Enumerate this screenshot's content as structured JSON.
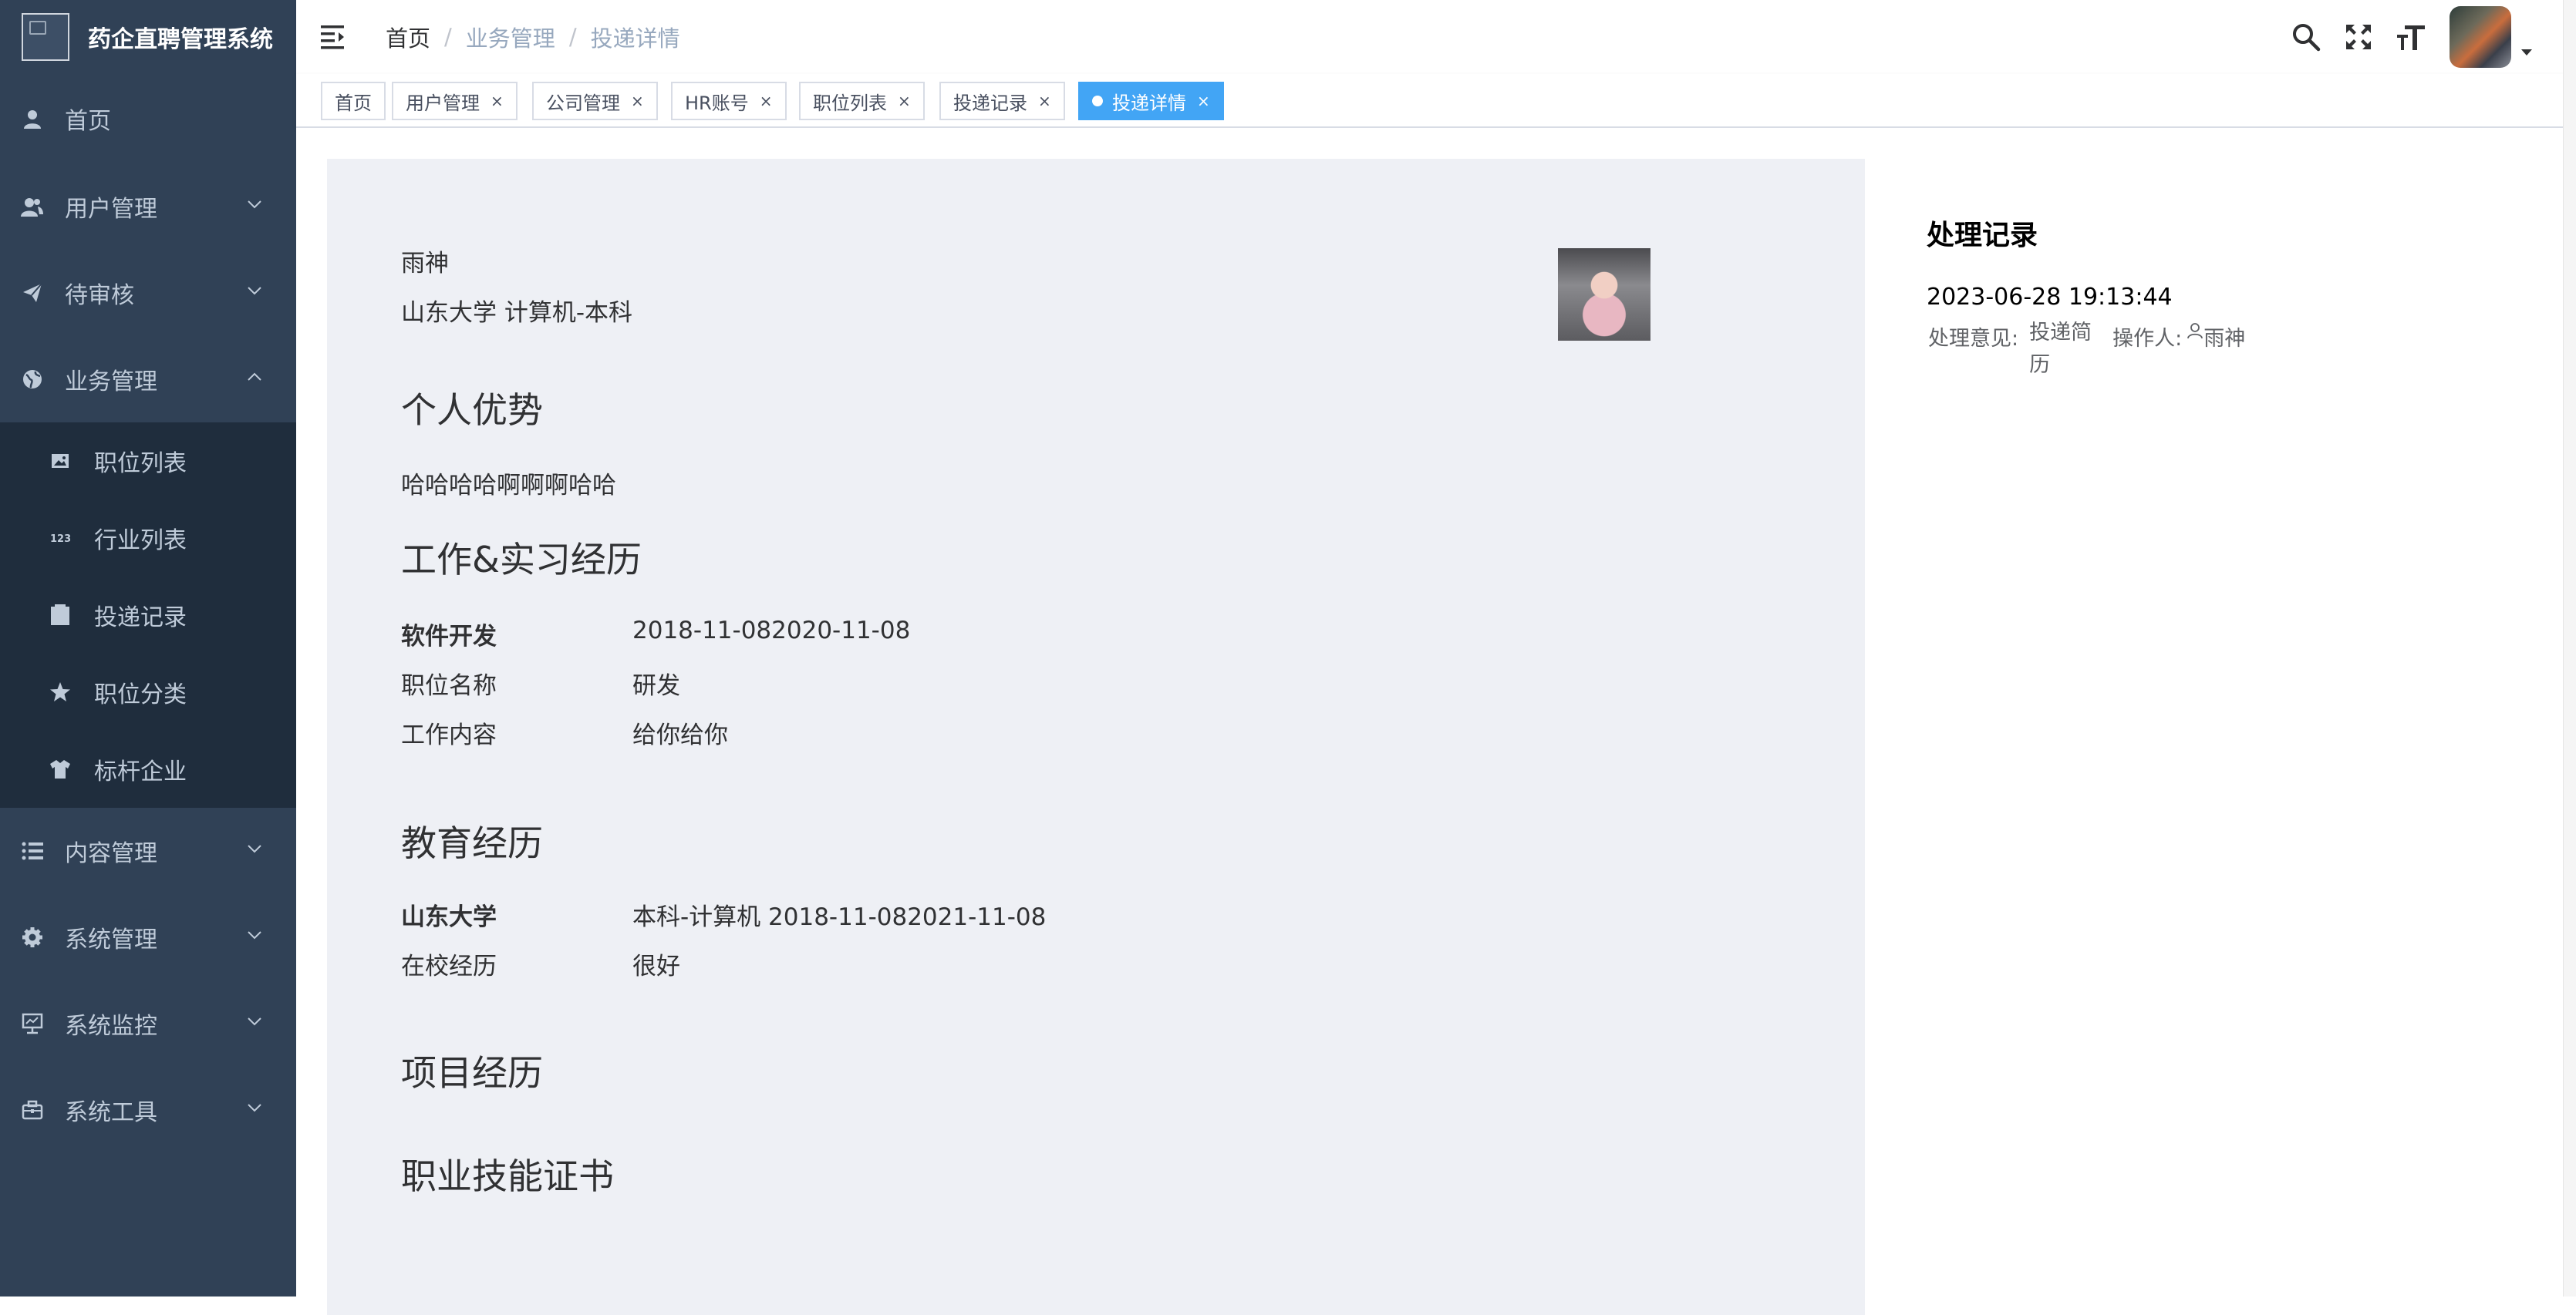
{
  "app": {
    "title": "药企直聘管理系统"
  },
  "sidebar": {
    "items": [
      {
        "label": "首页",
        "icon": "user-icon"
      },
      {
        "label": "用户管理",
        "icon": "peoples-icon"
      },
      {
        "label": "待审核",
        "icon": "send-icon"
      },
      {
        "label": "业务管理",
        "icon": "globe-icon"
      },
      {
        "label": "内容管理",
        "icon": "list-icon"
      },
      {
        "label": "系统管理",
        "icon": "gear-icon"
      },
      {
        "label": "系统监控",
        "icon": "monitor-icon"
      },
      {
        "label": "系统工具",
        "icon": "toolbox-icon"
      }
    ],
    "sub_items": [
      {
        "label": "职位列表",
        "icon": "image-icon"
      },
      {
        "label": "行业列表",
        "icon": "number-icon"
      },
      {
        "label": "投递记录",
        "icon": "clipboard-icon"
      },
      {
        "label": "职位分类",
        "icon": "star-icon"
      },
      {
        "label": "标杆企业",
        "icon": "shirt-icon"
      }
    ]
  },
  "breadcrumb": [
    "首页",
    "业务管理",
    "投递详情"
  ],
  "tags": [
    {
      "label": "首页"
    },
    {
      "label": "用户管理"
    },
    {
      "label": "公司管理"
    },
    {
      "label": "HR账号"
    },
    {
      "label": "职位列表"
    },
    {
      "label": "投递记录"
    },
    {
      "label": "投递详情"
    }
  ],
  "resume": {
    "name": "雨神",
    "school_line": "山东大学 计算机-本科",
    "advantage_title": "个人优势",
    "advantage_text": "哈哈哈哈啊啊啊哈哈",
    "work_title": "工作&实习经历",
    "work": {
      "company": "软件开发",
      "period": "2018-11-082020-11-08",
      "position_label": "职位名称",
      "position_value": "研发",
      "content_label": "工作内容",
      "content_value": "给你给你"
    },
    "edu_title": "教育经历",
    "edu": {
      "school": "山东大学",
      "detail": "本科-计算机 2018-11-082021-11-08",
      "exp_label": "在校经历",
      "exp_value": "很好"
    },
    "project_title": "项目经历",
    "cert_title": "职业技能证书"
  },
  "record": {
    "title": "处理记录",
    "time": "2023-06-28 19:13:44",
    "opinion_label": "处理意见:",
    "opinion_value": "投递简历",
    "operator_label": "操作人:",
    "operator_value": "雨神"
  },
  "colors": {
    "sidebar": "#304156",
    "submenu": "#1f2d3d",
    "tag_active": "#42a5f5",
    "content_bg": "#eef0f5"
  }
}
